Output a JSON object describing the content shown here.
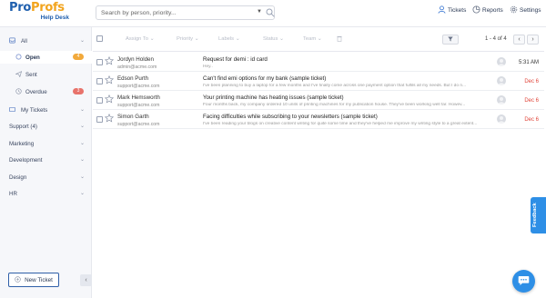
{
  "header": {
    "logo_text_a": "Pro",
    "logo_text_b": "Profs",
    "logo_sub": "Help Desk",
    "search_placeholder": "Search by person, priority...",
    "nav": [
      {
        "label": "Tickets",
        "icon": "user-icon"
      },
      {
        "label": "Reports",
        "icon": "reports-icon"
      },
      {
        "label": "Settings",
        "icon": "gear-icon"
      }
    ]
  },
  "sidebar": {
    "all": "All",
    "open": "Open",
    "open_count": "4",
    "sent": "Sent",
    "overdue": "Overdue",
    "overdue_count": "3",
    "my_tickets": "My Tickets",
    "groups": [
      "Support (4)",
      "Marketing",
      "Development",
      "Design",
      "HR"
    ],
    "new_ticket": "New Ticket",
    "collapse": "‹"
  },
  "toolbar": {
    "filters": [
      "Assign To",
      "Priority",
      "Labels",
      "Status",
      "Team"
    ],
    "pager": "1 - 4 of 4"
  },
  "tickets": [
    {
      "name": "Jordyn Holden",
      "email": "admin@acme.com",
      "subject": "Request for demi : id card",
      "preview": "Hey..",
      "date": "5:31 AM",
      "date_color": "#333333"
    },
    {
      "name": "Edson Purth",
      "email": "support@acme.com",
      "subject": "Can't find emi options for my bank (sample ticket)",
      "preview": "I've been planning to buy a laptop for a few months and I've finally come across one payment option that fulfils all my needs. But I do n...",
      "date": "Dec 6",
      "date_color": "#e0453a"
    },
    {
      "name": "Mark Hemsworth",
      "email": "support@acme.com",
      "subject": "Your printing machine has heating issues (sample ticket)",
      "preview": "Four months back, my company ordered 10 units of printing machines for my publication house. They've been working well far. Howev...",
      "date": "Dec 6",
      "date_color": "#e0453a"
    },
    {
      "name": "Simon Garth",
      "email": "support@acme.com",
      "subject": "Facing difficulties while subscribing to your newsletters (sample ticket)",
      "preview": "I've been reading your blogs on creative content writing for quite some time and they've helped me improve my writing style to a great extent...",
      "date": "Dec 6",
      "date_color": "#e0453a"
    }
  ],
  "widgets": {
    "feedback": "Feedback"
  },
  "colors": {
    "accent": "#2e8fe6",
    "brand": "#1f5fae",
    "badge_open": "#f2a93b",
    "badge_overdue": "#e8736b"
  }
}
